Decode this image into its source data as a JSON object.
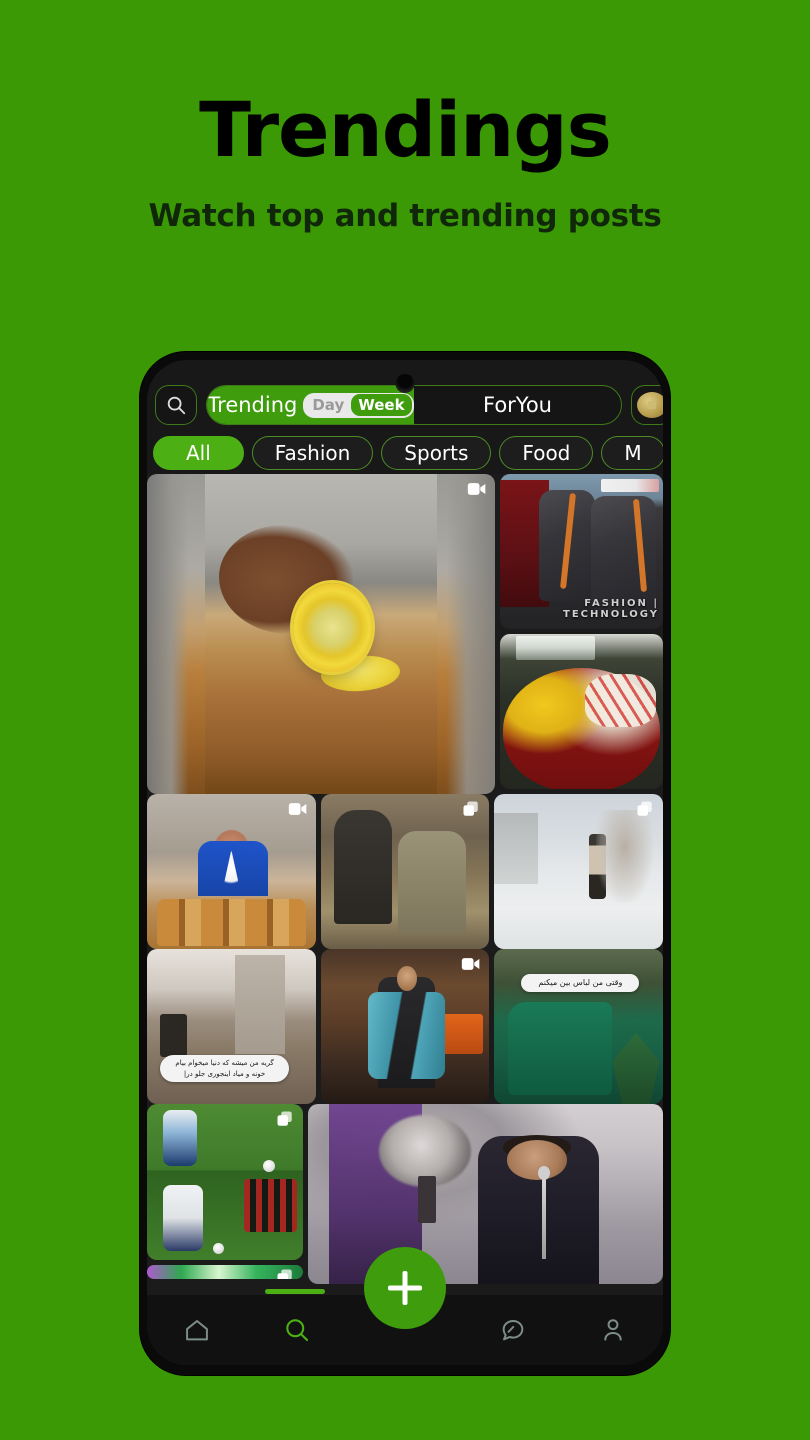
{
  "promo": {
    "title": "Trendings",
    "subtitle": "Watch top and trending posts",
    "background_color": "#3a9905",
    "accent_color": "#4caf13"
  },
  "app": {
    "topbar": {
      "search_icon": "search-icon",
      "tabs": [
        {
          "label": "Trending",
          "active": true
        },
        {
          "label": "ForYou",
          "active": false
        }
      ],
      "period_toggle": {
        "options": [
          {
            "label": "Day",
            "selected": false
          },
          {
            "label": "Week",
            "selected": true
          }
        ]
      },
      "avatar_icon": "avatar"
    },
    "categories": [
      {
        "label": "All",
        "active": true
      },
      {
        "label": "Fashion",
        "active": false
      },
      {
        "label": "Sports",
        "active": false
      },
      {
        "label": "Food",
        "active": false
      },
      {
        "label": "M",
        "active": false
      }
    ],
    "feed": {
      "row1": {
        "featured": {
          "name": "lemon-cutting-video",
          "badge": "video-icon"
        },
        "car": {
          "name": "car-seats-post",
          "caption": "FASHION | TECHNOLOGY",
          "badge": ""
        },
        "roses": {
          "name": "roses-bouquet-post",
          "badge": ""
        }
      },
      "row2": [
        {
          "name": "baker-pastries-post",
          "badge": "video-icon"
        },
        {
          "name": "group-of-men-post",
          "badge": "album-icon"
        },
        {
          "name": "snowy-street-post",
          "badge": "album-icon"
        }
      ],
      "row3": [
        {
          "name": "room-interior-post",
          "badge": "",
          "caption": "گریه من میشه که دنیا میخوام بیام خونه و میاد اینجوری جلو در|"
        },
        {
          "name": "denim-jacket-man-post",
          "badge": "video-icon"
        },
        {
          "name": "green-outfit-post",
          "badge": "",
          "caption": "وقتی من لباس بین میکنم"
        }
      ],
      "row4": [
        {
          "name": "soccer-collage-post",
          "badge": "album-icon"
        },
        {
          "name": "green-flash-post",
          "badge": "album-icon"
        },
        {
          "name": "singer-microphone-post",
          "badge": ""
        }
      ]
    },
    "navbar": {
      "items": [
        {
          "name": "nav-home",
          "icon": "home-icon",
          "active": false
        },
        {
          "name": "nav-search",
          "icon": "search-icon",
          "active": true
        },
        {
          "name": "nav-create",
          "icon": "plus-icon",
          "active": false
        },
        {
          "name": "nav-messages",
          "icon": "chat-bubble-icon",
          "active": false
        },
        {
          "name": "nav-profile",
          "icon": "person-icon",
          "active": false
        }
      ]
    }
  }
}
